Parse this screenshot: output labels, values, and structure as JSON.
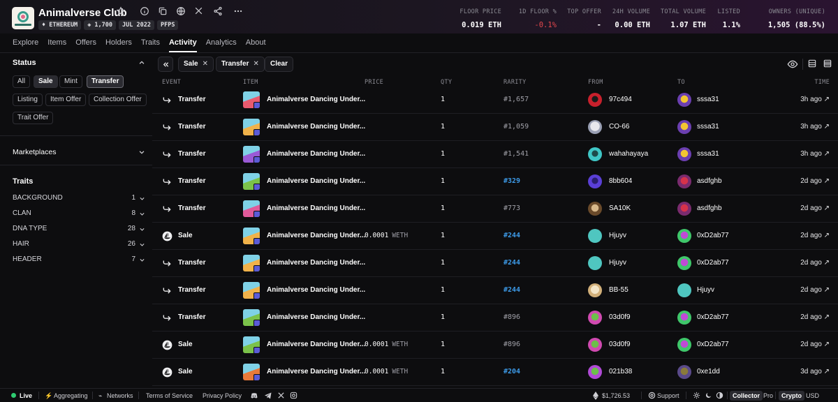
{
  "collection": {
    "name": "Animalverse Club",
    "chips": [
      "♦ ETHEREUM",
      "◈ 1,700",
      "JUL 2022",
      "PFPS"
    ]
  },
  "stats": [
    {
      "label": "FLOOR PRICE",
      "value": "0.019 ETH"
    },
    {
      "label": "1D FLOOR %",
      "value": "-0.1%"
    },
    {
      "label": "TOP OFFER",
      "value": "-"
    },
    {
      "label": "24H VOLUME",
      "value": "0.00 ETH"
    },
    {
      "label": "TOTAL VOLUME",
      "value": "1.07 ETH"
    },
    {
      "label": "LISTED",
      "value": "1.1%"
    },
    {
      "label": "OWNERS (UNIQUE)",
      "value": "1,505 (88.5%)"
    }
  ],
  "tabs": [
    "Explore",
    "Items",
    "Offers",
    "Holders",
    "Traits",
    "Activity",
    "Analytics",
    "About"
  ],
  "active_tab": "Activity",
  "sidebar": {
    "status_heading": "Status",
    "status_pills": [
      "All",
      "Sale",
      "Mint",
      "Transfer",
      "Listing",
      "Item Offer",
      "Collection Offer",
      "Trait Offer"
    ],
    "marketplaces_heading": "Marketplaces",
    "traits_heading": "Traits",
    "traits": [
      {
        "name": "BACKGROUND",
        "count": "1"
      },
      {
        "name": "CLAN",
        "count": "8"
      },
      {
        "name": "DNA TYPE",
        "count": "28"
      },
      {
        "name": "HAIR",
        "count": "26"
      },
      {
        "name": "HEADER",
        "count": "7"
      }
    ]
  },
  "filters": {
    "active": [
      "Sale",
      "Transfer"
    ],
    "clear_label": "Clear"
  },
  "columns": [
    "EVENT",
    "ITEM",
    "PRICE",
    "QTY",
    "RARITY",
    "FROM",
    "TO",
    "TIME"
  ],
  "rows": [
    {
      "event": "Transfer",
      "item": "Animalverse Dancing Under...",
      "price": "",
      "currency": "",
      "qty": "1",
      "rarity": "#1,657",
      "from": "97c494",
      "to": "sssa31",
      "time": "3h ago ↗"
    },
    {
      "event": "Transfer",
      "item": "Animalverse Dancing Under...",
      "price": "",
      "currency": "",
      "qty": "1",
      "rarity": "#1,059",
      "from": "CO-66",
      "to": "sssa31",
      "time": "3h ago ↗"
    },
    {
      "event": "Transfer",
      "item": "Animalverse Dancing Under...",
      "price": "",
      "currency": "",
      "qty": "1",
      "rarity": "#1,541",
      "from": "wahahayaya",
      "to": "sssa31",
      "time": "3h ago ↗"
    },
    {
      "event": "Transfer",
      "item": "Animalverse Dancing Under...",
      "price": "",
      "currency": "",
      "qty": "1",
      "rarity": "#329",
      "from": "8bb604",
      "to": "asdfghb",
      "time": "2d ago ↗"
    },
    {
      "event": "Transfer",
      "item": "Animalverse Dancing Under...",
      "price": "",
      "currency": "",
      "qty": "1",
      "rarity": "#773",
      "from": "SA10K",
      "to": "asdfghb",
      "time": "2d ago ↗"
    },
    {
      "event": "Sale",
      "item": "Animalverse Dancing Under...",
      "price": "0.0001",
      "currency": "WETH",
      "qty": "1",
      "rarity": "#244",
      "from": "Hjuyv",
      "to": "0xD2ab77",
      "time": "2d ago ↗"
    },
    {
      "event": "Transfer",
      "item": "Animalverse Dancing Under...",
      "price": "",
      "currency": "",
      "qty": "1",
      "rarity": "#244",
      "from": "Hjuyv",
      "to": "0xD2ab77",
      "time": "2d ago ↗"
    },
    {
      "event": "Transfer",
      "item": "Animalverse Dancing Under...",
      "price": "",
      "currency": "",
      "qty": "1",
      "rarity": "#244",
      "from": "BB-55",
      "to": "Hjuyv",
      "time": "2d ago ↗"
    },
    {
      "event": "Transfer",
      "item": "Animalverse Dancing Under...",
      "price": "",
      "currency": "",
      "qty": "1",
      "rarity": "#896",
      "from": "03d0f9",
      "to": "0xD2ab77",
      "time": "2d ago ↗"
    },
    {
      "event": "Sale",
      "item": "Animalverse Dancing Under...",
      "price": "0.0001",
      "currency": "WETH",
      "qty": "1",
      "rarity": "#896",
      "from": "03d0f9",
      "to": "0xD2ab77",
      "time": "2d ago ↗"
    },
    {
      "event": "Sale",
      "item": "Animalverse Dancing Under...",
      "price": "0.0001",
      "currency": "WETH",
      "qty": "1",
      "rarity": "#204",
      "from": "021b38",
      "to": "0xe1dd",
      "time": "3d ago ↗"
    }
  ],
  "footer": {
    "live": "Live",
    "aggregating": "Aggregating",
    "networks": "Networks",
    "terms": "Terms of Service",
    "privacy": "Privacy Policy",
    "eth_price": "$1,726.53",
    "support": "Support",
    "mode_on": "Collector",
    "mode_off": "Pro",
    "currency_on": "Crypto",
    "currency_off": "USD"
  },
  "colors": {
    "background": "#0d0d0f",
    "rarity_highlight": "#3d9be9",
    "negative": "#e5484d",
    "live": "#2ecc71"
  }
}
